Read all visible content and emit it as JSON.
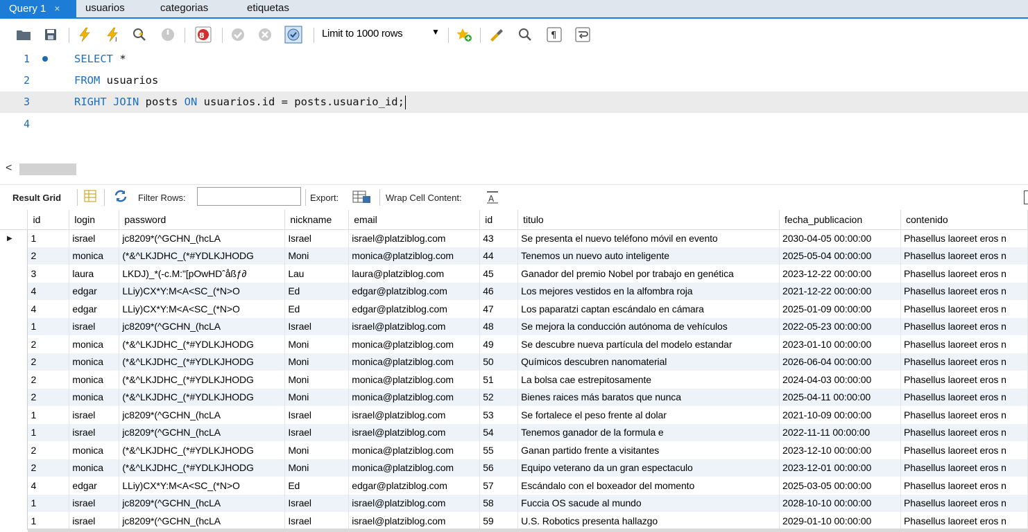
{
  "tabs": [
    {
      "label": "Query 1",
      "active": true,
      "close": "×"
    },
    {
      "label": "usuarios"
    },
    {
      "label": "categorias"
    },
    {
      "label": "etiquetas"
    }
  ],
  "toolbar": {
    "limit_select": "Limit to 1000 rows",
    "icons": [
      "open-file-icon",
      "save-icon",
      "execute-icon",
      "execute-current-icon",
      "explain-icon",
      "stop-icon",
      "stop-on-error-icon",
      "commit-icon",
      "rollback-icon",
      "autocommit-icon",
      "add-snippet-icon",
      "beautify-icon",
      "find-icon",
      "invisible-chars-icon",
      "wrap-icon"
    ]
  },
  "editor": {
    "lines": [
      {
        "num": "1",
        "tokens": [
          {
            "t": "SELECT",
            "kw": true
          },
          {
            "t": " *"
          }
        ]
      },
      {
        "num": "2",
        "tokens": [
          {
            "t": "FROM",
            "kw": true
          },
          {
            "t": " usuarios"
          }
        ]
      },
      {
        "num": "3",
        "tokens": [
          {
            "t": "RIGHT JOIN",
            "kw": true
          },
          {
            "t": " posts "
          },
          {
            "t": "ON",
            "kw": true
          },
          {
            "t": " usuarios.id = posts.usuario_id;"
          }
        ]
      },
      {
        "num": "4",
        "tokens": []
      }
    ],
    "keyword_color": "#1a6fc1"
  },
  "result_bar": {
    "result_grid": "Result Grid",
    "filter_rows": "Filter Rows:",
    "export": "Export:",
    "wrap": "Wrap Cell Content:"
  },
  "grid": {
    "columns": [
      "id",
      "login",
      "password",
      "nickname",
      "email",
      "id",
      "titulo",
      "fecha_publicacion",
      "contenido"
    ],
    "rows": [
      [
        "1",
        "israel",
        "jc8209*(^GCHN_(hcLA",
        "Israel",
        "israel@platziblog.com",
        "43",
        "Se presenta el nuevo teléfono móvil en evento",
        "2030-04-05 00:00:00",
        "Phasellus laoreet eros n"
      ],
      [
        "2",
        "monica",
        "(*&^LKJDHC_(*#YDLKJHODG",
        "Moni",
        "monica@platziblog.com",
        "44",
        "Tenemos un nuevo auto inteligente",
        "2025-05-04 00:00:00",
        "Phasellus laoreet eros n"
      ],
      [
        "3",
        "laura",
        "LKDJ)_*(-c.M:\"[pOwHDˆåßƒ∂",
        "Lau",
        "laura@platziblog.com",
        "45",
        "Ganador del premio Nobel por trabajo en genética",
        "2023-12-22 00:00:00",
        "Phasellus laoreet eros n"
      ],
      [
        "4",
        "edgar",
        "LLiy)CX*Y:M<A<SC_(*N>O",
        "Ed",
        "edgar@platziblog.com",
        "46",
        "Los mejores vestidos en la alfombra roja",
        "2021-12-22 00:00:00",
        "Phasellus laoreet eros n"
      ],
      [
        "4",
        "edgar",
        "LLiy)CX*Y:M<A<SC_(*N>O",
        "Ed",
        "edgar@platziblog.com",
        "47",
        "Los paparatzi captan escándalo en cámara",
        "2025-01-09 00:00:00",
        "Phasellus laoreet eros n"
      ],
      [
        "1",
        "israel",
        "jc8209*(^GCHN_(hcLA",
        "Israel",
        "israel@platziblog.com",
        "48",
        "Se mejora la conducción autónoma de vehículos",
        "2022-05-23 00:00:00",
        "Phasellus laoreet eros n"
      ],
      [
        "2",
        "monica",
        "(*&^LKJDHC_(*#YDLKJHODG",
        "Moni",
        "monica@platziblog.com",
        "49",
        "Se descubre nueva partícula del modelo estandar",
        "2023-01-10 00:00:00",
        "Phasellus laoreet eros n"
      ],
      [
        "2",
        "monica",
        "(*&^LKJDHC_(*#YDLKJHODG",
        "Moni",
        "monica@platziblog.com",
        "50",
        "Químicos descubren nanomaterial",
        "2026-06-04 00:00:00",
        "Phasellus laoreet eros n"
      ],
      [
        "2",
        "monica",
        "(*&^LKJDHC_(*#YDLKJHODG",
        "Moni",
        "monica@platziblog.com",
        "51",
        "La bolsa cae estrepitosamente",
        "2024-04-03 00:00:00",
        "Phasellus laoreet eros n"
      ],
      [
        "2",
        "monica",
        "(*&^LKJDHC_(*#YDLKJHODG",
        "Moni",
        "monica@platziblog.com",
        "52",
        "Bienes raices más baratos que nunca",
        "2025-04-11 00:00:00",
        "Phasellus laoreet eros n"
      ],
      [
        "1",
        "israel",
        "jc8209*(^GCHN_(hcLA",
        "Israel",
        "israel@platziblog.com",
        "53",
        "Se fortalece el peso frente al dolar",
        "2021-10-09 00:00:00",
        "Phasellus laoreet eros n"
      ],
      [
        "1",
        "israel",
        "jc8209*(^GCHN_(hcLA",
        "Israel",
        "israel@platziblog.com",
        "54",
        "Tenemos ganador de la formula e",
        "2022-11-11 00:00:00",
        "Phasellus laoreet eros n"
      ],
      [
        "2",
        "monica",
        "(*&^LKJDHC_(*#YDLKJHODG",
        "Moni",
        "monica@platziblog.com",
        "55",
        "Ganan partido frente a visitantes",
        "2023-12-10 00:00:00",
        "Phasellus laoreet eros n"
      ],
      [
        "2",
        "monica",
        "(*&^LKJDHC_(*#YDLKJHODG",
        "Moni",
        "monica@platziblog.com",
        "56",
        "Equipo veterano da un gran espectaculo",
        "2023-12-01 00:00:00",
        "Phasellus laoreet eros n"
      ],
      [
        "4",
        "edgar",
        "LLiy)CX*Y:M<A<SC_(*N>O",
        "Ed",
        "edgar@platziblog.com",
        "57",
        "Escándalo con el boxeador del momento",
        "2025-03-05 00:00:00",
        "Phasellus laoreet eros n"
      ],
      [
        "1",
        "israel",
        "jc8209*(^GCHN_(hcLA",
        "Israel",
        "israel@platziblog.com",
        "58",
        "Fuccia OS sacude al mundo",
        "2028-10-10 00:00:00",
        "Phasellus laoreet eros n"
      ],
      [
        "1",
        "israel",
        "jc8209*(^GCHN_(hcLA",
        "Israel",
        "israel@platziblog.com",
        "59",
        "U.S. Robotics presenta hallazgo",
        "2029-01-10 00:00:00",
        "Phasellus laoreet eros n"
      ]
    ],
    "selected_row_marker": "▶"
  }
}
